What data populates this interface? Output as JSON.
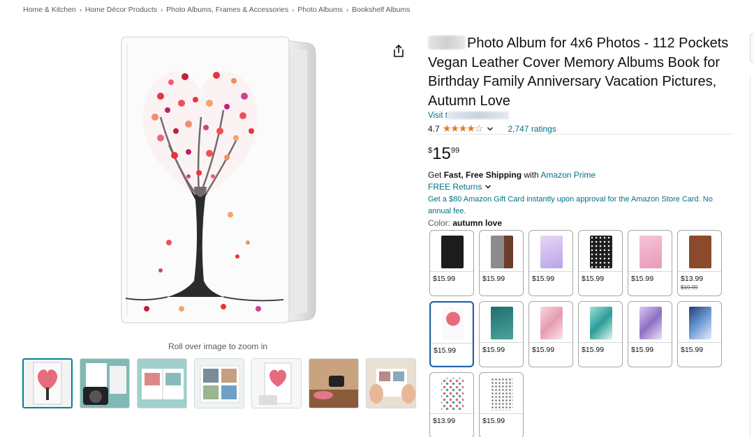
{
  "breadcrumb": [
    "Home & Kitchen",
    "Home Décor Products",
    "Photo Albums, Frames & Accessories",
    "Photo Albums",
    "Bookshelf Albums"
  ],
  "breadcrumb_separator": "›",
  "gallery": {
    "zoom_hint": "Roll over image to zoom in",
    "thumbnail_count": 7,
    "selected_thumbnail": 1
  },
  "product": {
    "title": "Photo Album for 4x6 Photos - 112 Pockets Vegan Leather Cover Memory Albums Book for Birthday Family Anniversary Vacation Pictures, Autumn Love",
    "visit_prefix": "Visit t",
    "rating": "4.7",
    "stars_glyph": "★★★★☆",
    "ratings_count": "2,747 ratings",
    "price": {
      "symbol": "$",
      "whole": "15",
      "fraction": "99"
    },
    "shipping": {
      "prefix": "Get ",
      "bold": "Fast, Free Shipping",
      "middle": " with ",
      "link": "Amazon Prime"
    },
    "returns": "FREE Returns",
    "gift_card": "Get a $80 Amazon Gift Card instantly upon approval for the Amazon Store Card. No annual fee.",
    "color_label": "Color: ",
    "color_value": "autumn love"
  },
  "swatches": [
    {
      "price": "$15.99",
      "strike": "",
      "style": "black"
    },
    {
      "price": "$15.99",
      "strike": "",
      "style": "gray-brown"
    },
    {
      "price": "$15.99",
      "strike": "",
      "style": "lavender"
    },
    {
      "price": "$15.99",
      "strike": "",
      "style": "black-dots"
    },
    {
      "price": "$15.99",
      "strike": "",
      "style": "pink-glitter"
    },
    {
      "price": "$13.99",
      "strike": "$19.99",
      "style": "brown"
    },
    {
      "price": "$15.99",
      "strike": "",
      "style": "tree-heart",
      "selected": true
    },
    {
      "price": "$15.99",
      "strike": "",
      "style": "teal-floral"
    },
    {
      "price": "$15.99",
      "strike": "",
      "style": "pink-marble"
    },
    {
      "price": "$15.99",
      "strike": "",
      "style": "teal-marble"
    },
    {
      "price": "$15.99",
      "strike": "",
      "style": "purple-marble"
    },
    {
      "price": "$15.99",
      "strike": "",
      "style": "blue-marble"
    },
    {
      "price": "$13.99",
      "strike": "",
      "style": "butterflies"
    },
    {
      "price": "$15.99",
      "strike": "",
      "style": "white-dots"
    }
  ],
  "colors": {
    "link": "#007185",
    "star": "#de7921",
    "selected_border": "#2162a1",
    "thumb_selected": "#008296"
  },
  "icons": [
    "share-icon",
    "chevron-down-icon"
  ]
}
